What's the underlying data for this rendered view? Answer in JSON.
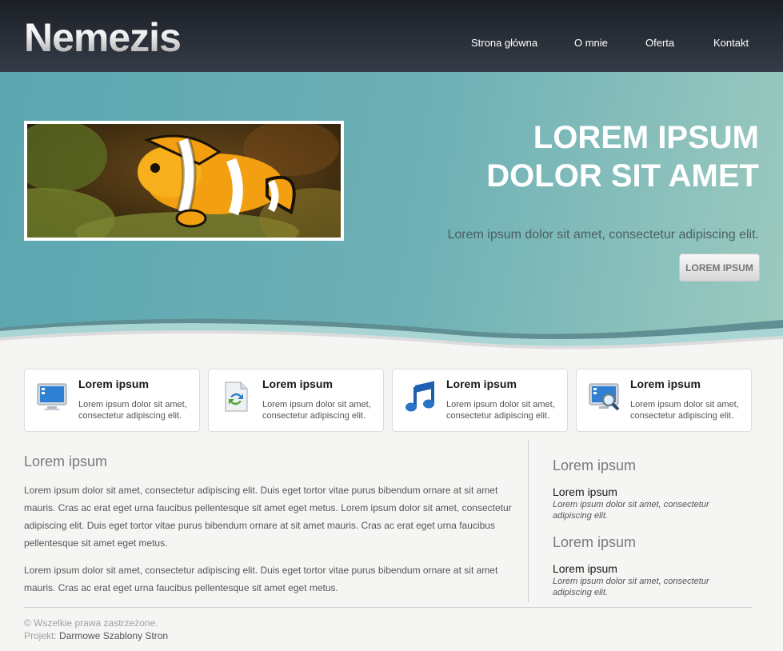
{
  "header": {
    "logo": "Nemezis",
    "nav": [
      {
        "label": "Strona główna"
      },
      {
        "label": "O mnie"
      },
      {
        "label": "Oferta"
      },
      {
        "label": "Kontakt"
      }
    ]
  },
  "hero": {
    "title_line1": "LOREM IPSUM",
    "title_line2": "DOLOR SIT AMET",
    "subtitle": "Lorem ipsum dolor sit amet, consectetur adipiscing elit.",
    "button": "LOREM IPSUM",
    "image": "clownfish-photo"
  },
  "features": [
    {
      "icon": "monitor-icon",
      "title": "Lorem ipsum",
      "text": "Lorem ipsum dolor sit amet, consectetur adipiscing elit."
    },
    {
      "icon": "file-refresh-icon",
      "title": "Lorem ipsum",
      "text": "Lorem ipsum dolor sit amet, consectetur adipiscing elit."
    },
    {
      "icon": "music-note-icon",
      "title": "Lorem ipsum",
      "text": "Lorem ipsum dolor sit amet, consectetur adipiscing elit."
    },
    {
      "icon": "monitor-search-icon",
      "title": "Lorem ipsum",
      "text": "Lorem ipsum dolor sit amet, consectetur adipiscing elit."
    }
  ],
  "main": {
    "heading": "Lorem ipsum",
    "paragraphs": [
      "Lorem ipsum dolor sit amet, consectetur adipiscing elit. Duis eget tortor vitae purus bibendum ornare at sit amet mauris. Cras ac erat eget urna faucibus pellentesque sit amet eget metus. Lorem ipsum dolor sit amet, consectetur adipiscing elit. Duis eget tortor vitae purus bibendum ornare at sit amet mauris. Cras ac erat eget urna faucibus pellentesque sit amet eget metus.",
      "Lorem ipsum dolor sit amet, consectetur adipiscing elit. Duis eget tortor vitae purus bibendum ornare at sit amet mauris. Cras ac erat eget urna faucibus pellentesque sit amet eget metus."
    ]
  },
  "sidebar": {
    "sections": [
      {
        "heading": "Lorem ipsum",
        "item_title": "Lorem ipsum",
        "item_desc": "Lorem ipsum dolor sit amet, consectetur adipiscing elit."
      },
      {
        "heading": "Lorem ipsum",
        "item_title": "Lorem ipsum",
        "item_desc": "Lorem ipsum dolor sit amet, consectetur adipiscing elit."
      }
    ]
  },
  "footer": {
    "copyright": "© Wszelkie prawa zastrzeżone.",
    "project_label": "Projekt:",
    "project_link": "Darmowe Szablony Stron"
  }
}
